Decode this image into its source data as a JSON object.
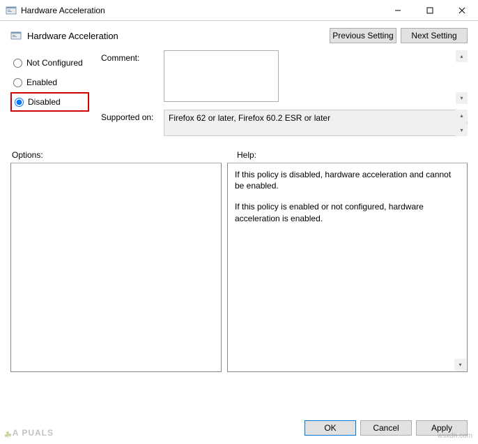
{
  "window": {
    "title": "Hardware Acceleration"
  },
  "header": {
    "title": "Hardware Acceleration"
  },
  "nav": {
    "previous": "Previous Setting",
    "next": "Next Setting"
  },
  "radios": {
    "not_configured": "Not Configured",
    "enabled": "Enabled",
    "disabled": "Disabled",
    "selected": "disabled"
  },
  "fields": {
    "comment_label": "Comment:",
    "comment_value": "",
    "supported_label": "Supported on:",
    "supported_value": "Firefox 62 or later, Firefox 60.2 ESR or later"
  },
  "sections": {
    "options_label": "Options:",
    "help_label": "Help:"
  },
  "help": {
    "p1": "If this policy is disabled, hardware acceleration and cannot be enabled.",
    "p2": "If this policy is enabled or not configured, hardware acceleration is enabled."
  },
  "footer": {
    "ok": "OK",
    "cancel": "Cancel",
    "apply": "Apply"
  },
  "watermark": {
    "left": "A PUALS",
    "right": "wsxdn.com"
  }
}
